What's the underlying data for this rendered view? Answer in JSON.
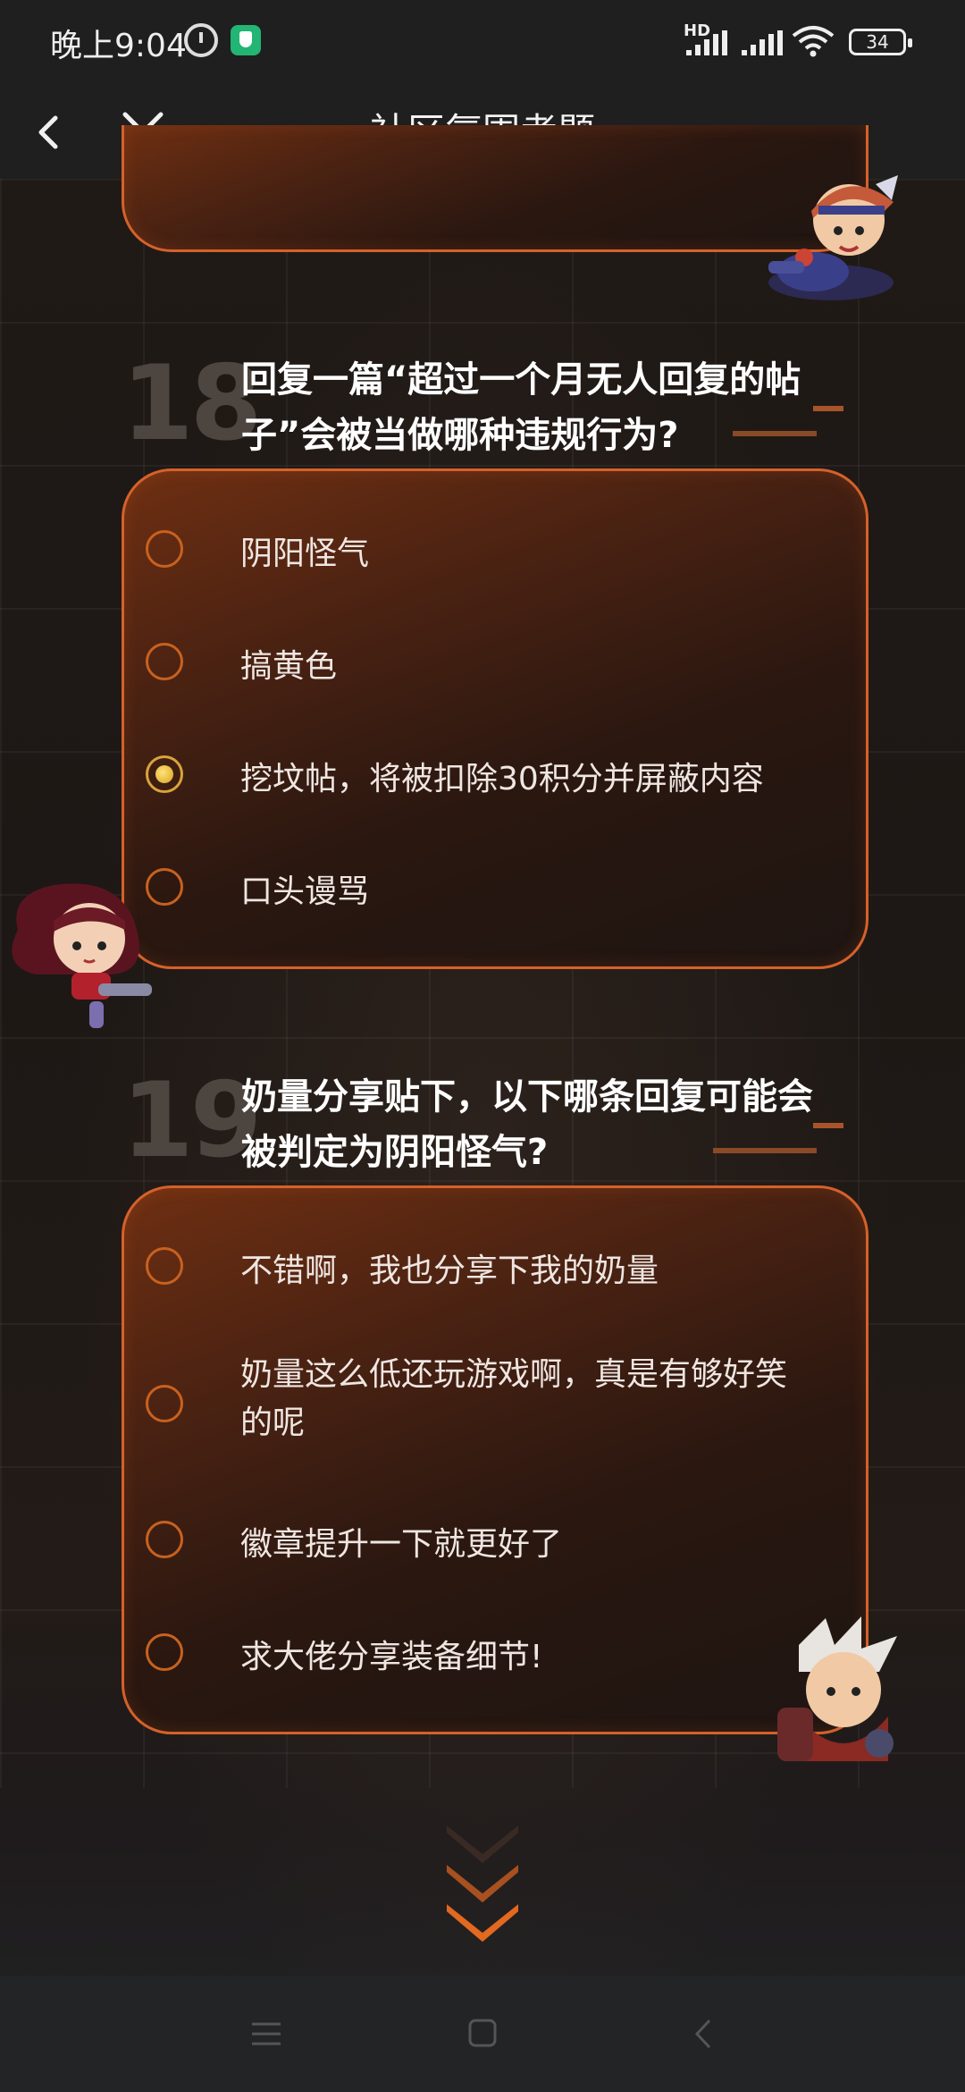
{
  "status_bar": {
    "time": "晚上9:04",
    "hd_label": "HD",
    "battery": "34"
  },
  "header": {
    "title": "社区氛围考题",
    "back_icon": "chevron-left-icon",
    "close_icon": "close-icon"
  },
  "questions": [
    {
      "number": "18",
      "text": "回复一篇“超过一个月无人回复的帖子”会被当做哪种违规行为?",
      "options": [
        {
          "label": "阴阳怪气",
          "selected": false
        },
        {
          "label": "搞黄色",
          "selected": false
        },
        {
          "label": "挖坟帖，将被扣除30积分并屏蔽内容",
          "selected": true
        },
        {
          "label": "口头谩骂",
          "selected": false
        }
      ]
    },
    {
      "number": "19",
      "text": "奶量分享贴下，以下哪条回复可能会被判定为阴阳怪气?",
      "options": [
        {
          "label": "不错啊，我也分享下我的奶量",
          "selected": false
        },
        {
          "label": "奶量这么低还玩游戏啊，真是有够好笑的呢",
          "selected": false
        },
        {
          "label": "徽章提升一下就更好了",
          "selected": false
        },
        {
          "label": "求大佬分享装备细节!",
          "selected": false
        }
      ]
    }
  ],
  "colors": {
    "accent": "#d5612a",
    "selected": "#e0b030",
    "background": "#1d1815"
  },
  "nav": {
    "menu_icon": "menu-icon",
    "home_icon": "square-home-icon",
    "back_icon": "nav-back-icon"
  }
}
